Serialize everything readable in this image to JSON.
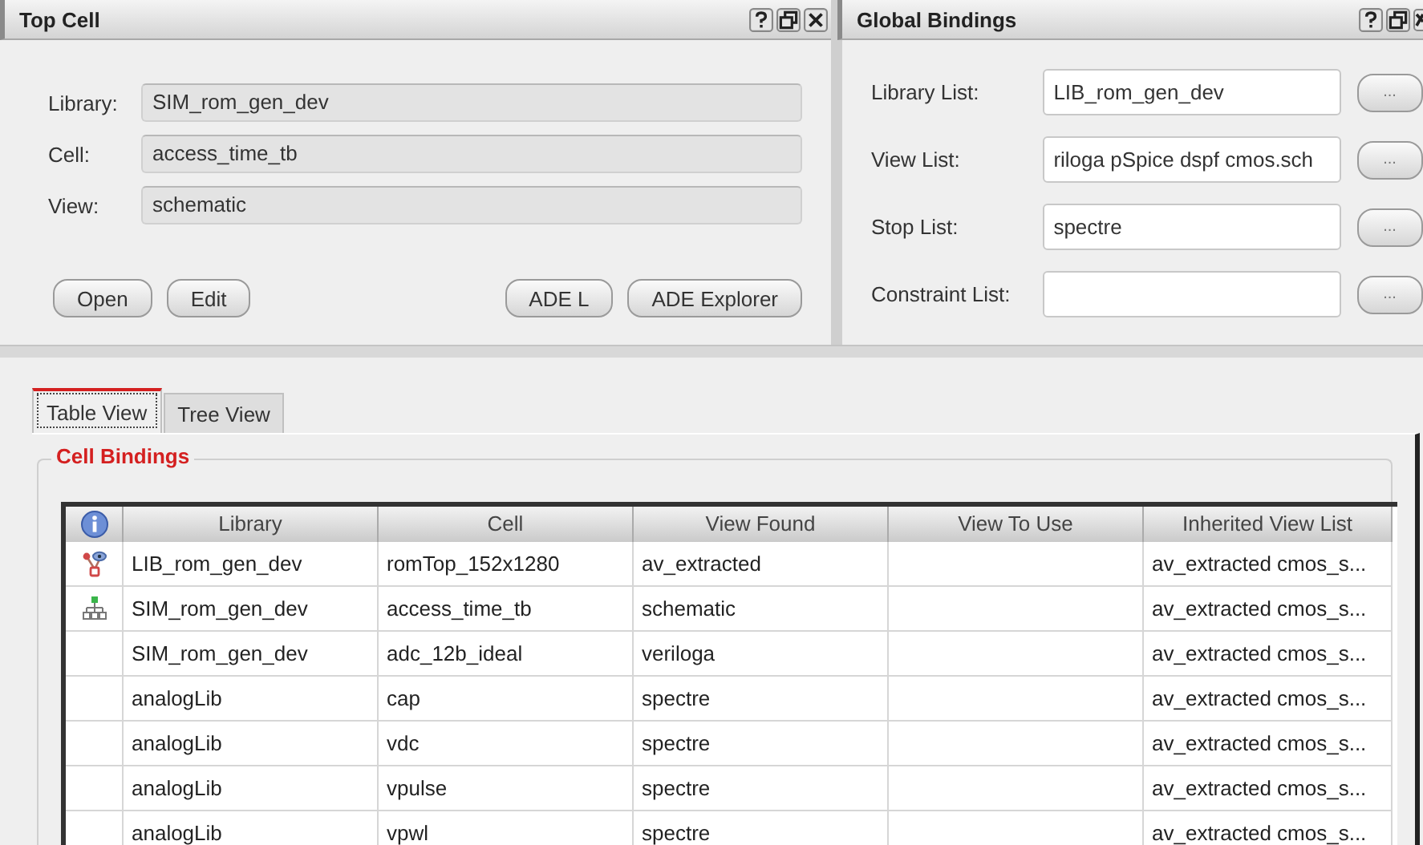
{
  "top_cell": {
    "title": "Top Cell",
    "fields": [
      {
        "label": "Library:",
        "value": "SIM_rom_gen_dev"
      },
      {
        "label": "Cell:",
        "value": "access_time_tb"
      },
      {
        "label": "View:",
        "value": "schematic"
      }
    ],
    "left_buttons": [
      "Open",
      "Edit"
    ],
    "right_buttons": [
      "ADE L",
      "ADE Explorer"
    ]
  },
  "global_bindings": {
    "title": "Global Bindings",
    "fields": [
      {
        "label": "Library List:",
        "value": "LIB_rom_gen_dev",
        "button": "..."
      },
      {
        "label": "View List:",
        "value": "riloga pSpice dspf cmos.sch",
        "button": "..."
      },
      {
        "label": "Stop List:",
        "value": "spectre",
        "button": "..."
      },
      {
        "label": "Constraint List:",
        "button": "..."
      }
    ]
  },
  "tabs": [
    {
      "label": "Table View",
      "selected": true
    },
    {
      "label": "Tree View",
      "selected": false
    }
  ],
  "cell_bindings": {
    "title": "Cell Bindings",
    "columns": [
      "Library",
      "Cell",
      "View Found",
      "View To Use",
      "Inherited View List"
    ],
    "rows": [
      {
        "kind": "extracted",
        "cells": [
          "LIB_rom_gen_dev",
          "romTop_152x1280",
          "av_extracted",
          "",
          "av_extracted cmos_s..."
        ]
      },
      {
        "kind": "hierarchy",
        "cells": [
          "SIM_rom_gen_dev",
          "access_time_tb",
          "schematic",
          "",
          "av_extracted cmos_s..."
        ]
      },
      {
        "kind": "plain",
        "cells": [
          "SIM_rom_gen_dev",
          "adc_12b_ideal",
          "veriloga",
          "",
          "av_extracted cmos_s..."
        ]
      },
      {
        "kind": "plain",
        "cells": [
          "analogLib",
          "cap",
          "spectre",
          "",
          "av_extracted cmos_s..."
        ]
      },
      {
        "kind": "plain",
        "cells": [
          "analogLib",
          "vdc",
          "spectre",
          "",
          "av_extracted cmos_s..."
        ]
      },
      {
        "kind": "plain",
        "cells": [
          "analogLib",
          "vpulse",
          "spectre",
          "",
          "av_extracted cmos_s..."
        ]
      },
      {
        "kind": "plain",
        "cells": [
          "analogLib",
          "vpwl",
          "spectre",
          "",
          "av_extracted cmos_s..."
        ]
      }
    ]
  }
}
